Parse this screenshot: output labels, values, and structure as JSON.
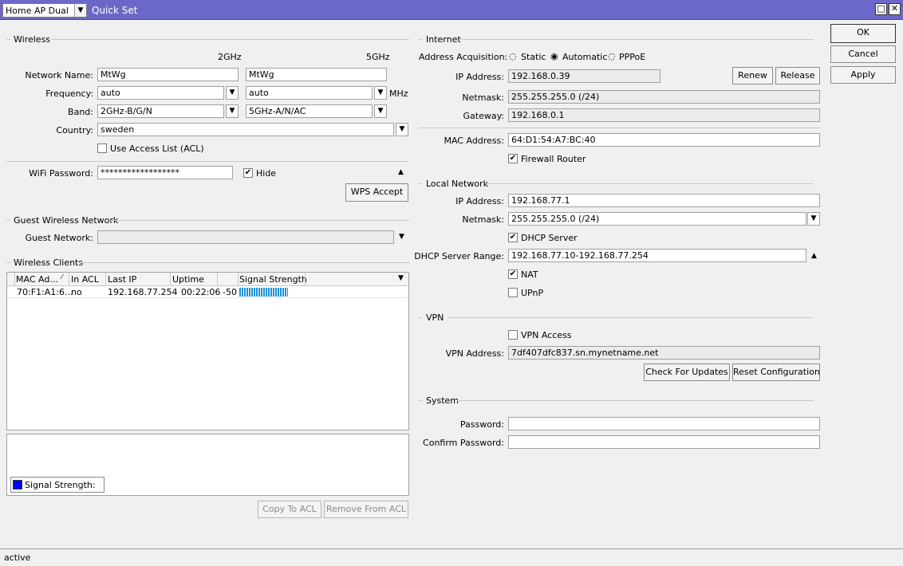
{
  "titlebar": {
    "mode": "Home AP Dual",
    "title": "Quick Set"
  },
  "buttons": {
    "ok": "OK",
    "cancel": "Cancel",
    "apply": "Apply"
  },
  "wireless": {
    "section": "Wireless",
    "col2": "2GHz",
    "col5": "5GHz",
    "network_name_label": "Network Name:",
    "network_name_2": "MtWg",
    "network_name_5": "MtWg",
    "frequency_label": "Frequency:",
    "frequency_2": "auto",
    "frequency_5": "auto",
    "mhz": "MHz",
    "band_label": "Band:",
    "band_2": "2GHz-B/G/N",
    "band_5": "5GHz-A/N/AC",
    "country_label": "Country:",
    "country": "sweden",
    "acl_label": "Use Access List (ACL)",
    "wifi_password_label": "WiFi Password:",
    "wifi_password": "******************",
    "hide_label": "Hide",
    "wps_button": "WPS Accept"
  },
  "guest": {
    "section": "Guest Wireless Network",
    "label": "Guest Network:",
    "value": ""
  },
  "clients": {
    "section": "Wireless Clients",
    "columns": [
      "MAC Ad...",
      "In ACL",
      "Last IP",
      "Uptime",
      "",
      "Signal Strength"
    ],
    "rows": [
      {
        "mac": "70:F1:A1:6...",
        "in_acl": "no",
        "last_ip": "192.168.77.254",
        "uptime": "00:22:06",
        "signal": "-50",
        "strength": 0.76
      }
    ],
    "legend": "Signal Strength:",
    "copy_button": "Copy To ACL",
    "remove_button": "Remove From ACL"
  },
  "internet": {
    "section": "Internet",
    "acq_label": "Address Acquisition:",
    "acq_options": [
      "Static",
      "Automatic",
      "PPPoE"
    ],
    "ip_label": "IP Address:",
    "ip": "192.168.0.39",
    "renew": "Renew",
    "release": "Release",
    "netmask_label": "Netmask:",
    "netmask": "255.255.255.0 (/24)",
    "gateway_label": "Gateway:",
    "gateway": "192.168.0.1",
    "mac_label": "MAC Address:",
    "mac": "64:D1:54:A7:BC:40",
    "firewall_label": "Firewall Router"
  },
  "local": {
    "section": "Local Network",
    "ip_label": "IP Address:",
    "ip": "192.168.77.1",
    "netmask_label": "Netmask:",
    "netmask": "255.255.255.0 (/24)",
    "dhcp_label": "DHCP Server",
    "range_label": "DHCP Server Range:",
    "range": "192.168.77.10-192.168.77.254",
    "nat_label": "NAT",
    "upnp_label": "UPnP"
  },
  "vpn": {
    "section": "VPN",
    "access_label": "VPN Access",
    "address_label": "VPN Address:",
    "address": "7df407dfc837.sn.mynetname.net",
    "check_updates": "Check For Updates",
    "reset_config": "Reset Configuration"
  },
  "system": {
    "section": "System",
    "password_label": "Password:",
    "confirm_label": "Confirm Password:"
  },
  "status": {
    "text": "active"
  },
  "colors": {
    "titlebar": "#6c68c9",
    "signal_bar": "#1e90d6",
    "legend_swatch": "#0000ff"
  }
}
